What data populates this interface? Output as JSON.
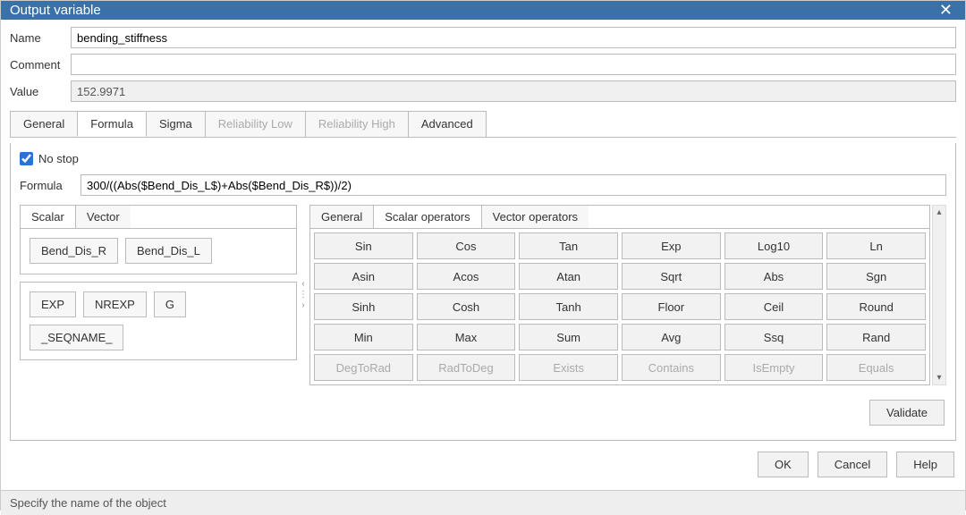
{
  "title": "Output variable",
  "fields": {
    "name_label": "Name",
    "name_value": "bending_stiffness",
    "comment_label": "Comment",
    "comment_value": "",
    "value_label": "Value",
    "value_value": "152.9971",
    "formula_label": "Formula",
    "formula_value": "300/((Abs($Bend_Dis_L$)+Abs($Bend_Dis_R$))/2)"
  },
  "tabs": {
    "general": "General",
    "formula": "Formula",
    "sigma": "Sigma",
    "rel_low": "Reliability Low",
    "rel_high": "Reliability High",
    "advanced": "Advanced"
  },
  "no_stop_label": "No stop",
  "no_stop_checked": true,
  "var_tabs": {
    "scalar": "Scalar",
    "vector": "Vector"
  },
  "vars_top": [
    "Bend_Dis_R",
    "Bend_Dis_L"
  ],
  "vars_bottom": [
    "EXP",
    "NREXP",
    "G",
    "_SEQNAME_"
  ],
  "ops_tabs": {
    "general": "General",
    "scalar": "Scalar operators",
    "vector": "Vector operators"
  },
  "ops": [
    [
      "Sin",
      "Cos",
      "Tan",
      "Exp",
      "Log10",
      "Ln"
    ],
    [
      "Asin",
      "Acos",
      "Atan",
      "Sqrt",
      "Abs",
      "Sgn"
    ],
    [
      "Sinh",
      "Cosh",
      "Tanh",
      "Floor",
      "Ceil",
      "Round"
    ],
    [
      "Min",
      "Max",
      "Sum",
      "Avg",
      "Ssq",
      "Rand"
    ],
    [
      "DegToRad",
      "RadToDeg",
      "Exists",
      "Contains",
      "IsEmpty",
      "Equals"
    ]
  ],
  "buttons": {
    "validate": "Validate",
    "ok": "OK",
    "cancel": "Cancel",
    "help": "Help"
  },
  "status": "Specify the name of the object"
}
